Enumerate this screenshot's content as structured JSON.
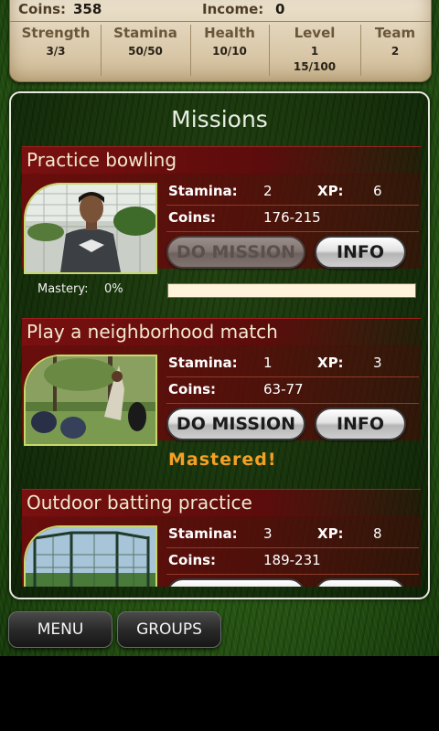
{
  "header": {
    "coins_label": "Coins:",
    "coins_value": "358",
    "income_label": "Income:",
    "income_value": "0",
    "stats": [
      {
        "name": "Strength",
        "value": "3/3",
        "extra": ""
      },
      {
        "name": "Stamina",
        "value": "50/50",
        "extra": ""
      },
      {
        "name": "Health",
        "value": "10/10",
        "extra": ""
      },
      {
        "name": "Level",
        "value": "1",
        "extra": "15/100"
      },
      {
        "name": "Team",
        "value": "2",
        "extra": ""
      }
    ]
  },
  "panel": {
    "title": "Missions"
  },
  "missions": [
    {
      "title": "Practice bowling",
      "stamina_label": "Stamina:",
      "stamina": "2",
      "xp_label": "XP:",
      "xp": "6",
      "coins_label": "Coins:",
      "coins": "176-215",
      "do_label": "DO MISSION",
      "do_enabled": false,
      "info_label": "INFO",
      "mastery_label": "Mastery:",
      "mastery_value": "0%",
      "mastery_fraction": 0.0
    },
    {
      "title": "Play a neighborhood match",
      "stamina_label": "Stamina:",
      "stamina": "1",
      "xp_label": "XP:",
      "xp": "3",
      "coins_label": "Coins:",
      "coins": "63-77",
      "do_label": "DO MISSION",
      "do_enabled": true,
      "info_label": "INFO",
      "status": "Mastered!"
    },
    {
      "title": "Outdoor batting practice",
      "stamina_label": "Stamina:",
      "stamina": "3",
      "xp_label": "XP:",
      "xp": "8",
      "coins_label": "Coins:",
      "coins": "189-231",
      "do_label": "DO MISSION",
      "do_enabled": true,
      "info_label": "INFO"
    }
  ],
  "nav": {
    "menu_label": "MENU",
    "groups_label": "GROUPS"
  },
  "colors": {
    "mission_header": "#7a1010",
    "mastered_text": "#f5a025",
    "panel_border": "#e8e8e0"
  }
}
